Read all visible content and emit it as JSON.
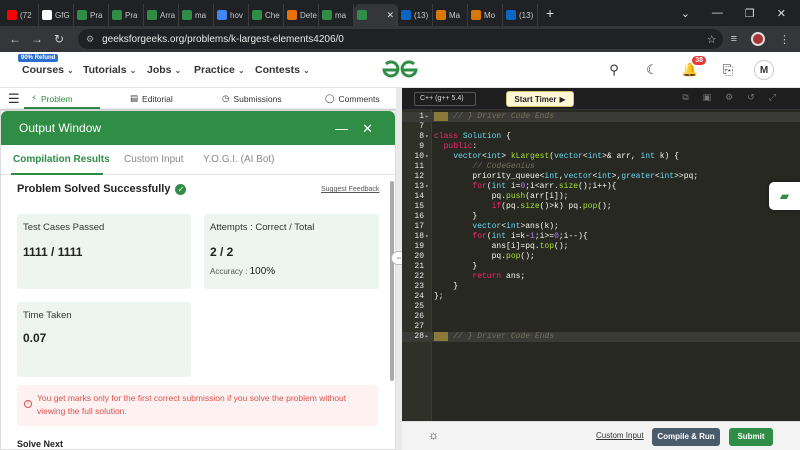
{
  "browser": {
    "tabs": [
      {
        "icon": "youtube-icon",
        "color": "#ff0000",
        "label": "(72"
      },
      {
        "icon": "github-icon",
        "color": "#ffffff",
        "label": "GfG"
      },
      {
        "icon": "gfg-icon",
        "color": "#2f8d46",
        "label": "Pra"
      },
      {
        "icon": "gfg-icon",
        "color": "#2f8d46",
        "label": "Pra"
      },
      {
        "icon": "gfg-icon",
        "color": "#2f8d46",
        "label": "Arra"
      },
      {
        "icon": "gfg-icon",
        "color": "#2f8d46",
        "label": "ma"
      },
      {
        "icon": "google-icon",
        "color": "#4285f4",
        "label": "hov"
      },
      {
        "icon": "gfg-icon",
        "color": "#2f8d46",
        "label": "Che"
      },
      {
        "icon": "spark-icon",
        "color": "#e8710a",
        "label": "Dete"
      },
      {
        "icon": "gfg-icon",
        "color": "#2f8d46",
        "label": "ma"
      },
      {
        "icon": "gfg-icon",
        "color": "#2f8d46",
        "label": ""
      },
      {
        "icon": "linkedin-icon",
        "color": "#0a66c2",
        "label": "(13)"
      },
      {
        "icon": "claude-icon",
        "color": "#d97706",
        "label": "Ma"
      },
      {
        "icon": "claude-icon",
        "color": "#d97706",
        "label": "Mo"
      },
      {
        "icon": "linkedin-icon",
        "color": "#0a66c2",
        "label": "(13)"
      }
    ],
    "url": "geeksforgeeks.org/problems/k-largest-elements4206/0"
  },
  "header": {
    "refund_badge": "90% Refund",
    "nav": [
      "Courses",
      "Tutorials",
      "Jobs",
      "Practice",
      "Contests"
    ],
    "notification_count": "38",
    "avatar_letter": "M"
  },
  "problem_tabs": [
    "Problem",
    "Editorial",
    "Submissions",
    "Comments"
  ],
  "output": {
    "title": "Output Window",
    "tabs": [
      "Compilation Results",
      "Custom Input",
      "Y.O.G.I. (AI Bot)"
    ],
    "status": "Problem Solved Successfully",
    "feedback_link": "Suggest Feedback",
    "test_cases_label": "Test Cases Passed",
    "test_cases_value": "1111 / 1111",
    "attempts_label": "Attempts : Correct / Total",
    "attempts_value": "2 / 2",
    "accuracy_label": "Accuracy :",
    "accuracy_value": "100%",
    "time_label": "Time Taken",
    "time_value": "0.07",
    "warning": "You get marks only for the first correct submission if you solve the problem without viewing the full solution.",
    "next_heading": "Solve Next"
  },
  "editor": {
    "language": "C++ (g++ 5.4)",
    "timer_label": "Start Timer",
    "custom_input_link": "Custom Input",
    "run_label": "Compile & Run",
    "submit_label": "Submit"
  },
  "colors": {
    "brand_green": "#2f8d46",
    "editor_bg": "#272822"
  }
}
